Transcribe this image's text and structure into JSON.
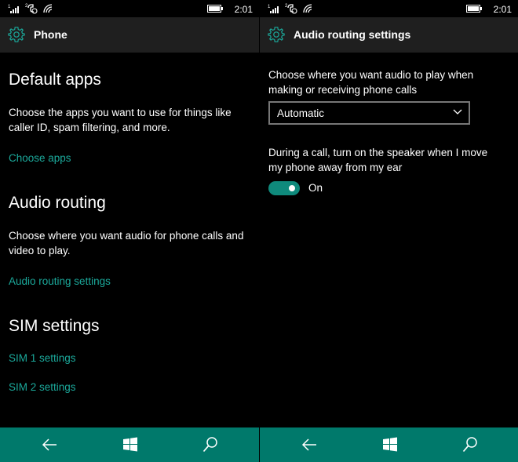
{
  "status_bar": {
    "time": "2:01"
  },
  "left": {
    "title": "Phone",
    "default_apps": {
      "heading": "Default apps",
      "description": "Choose the apps you want to use for things like caller ID, spam filtering, and more.",
      "link": "Choose apps"
    },
    "audio_routing": {
      "heading": "Audio routing",
      "description": "Choose where you want audio for phone calls and video to play.",
      "link": "Audio routing settings"
    },
    "sim_settings": {
      "heading": "SIM settings",
      "sim1": "SIM 1 settings",
      "sim2": "SIM 2 settings"
    }
  },
  "right": {
    "title": "Audio routing settings",
    "choose_label": "Choose where you want audio to play when making or receiving phone calls",
    "dropdown_value": "Automatic",
    "speaker_label": "During a call, turn on the speaker when I move my phone away from my ear",
    "toggle": {
      "state": "On",
      "checked": true
    }
  },
  "nav_icons": [
    "back-arrow-icon",
    "windows-start-icon",
    "search-icon"
  ],
  "colors": {
    "accent": "#1ba99b",
    "navbar": "#00796b",
    "toggle_on": "#0f8a7c",
    "title_bar": "#1f1f1f",
    "background": "#000000"
  }
}
